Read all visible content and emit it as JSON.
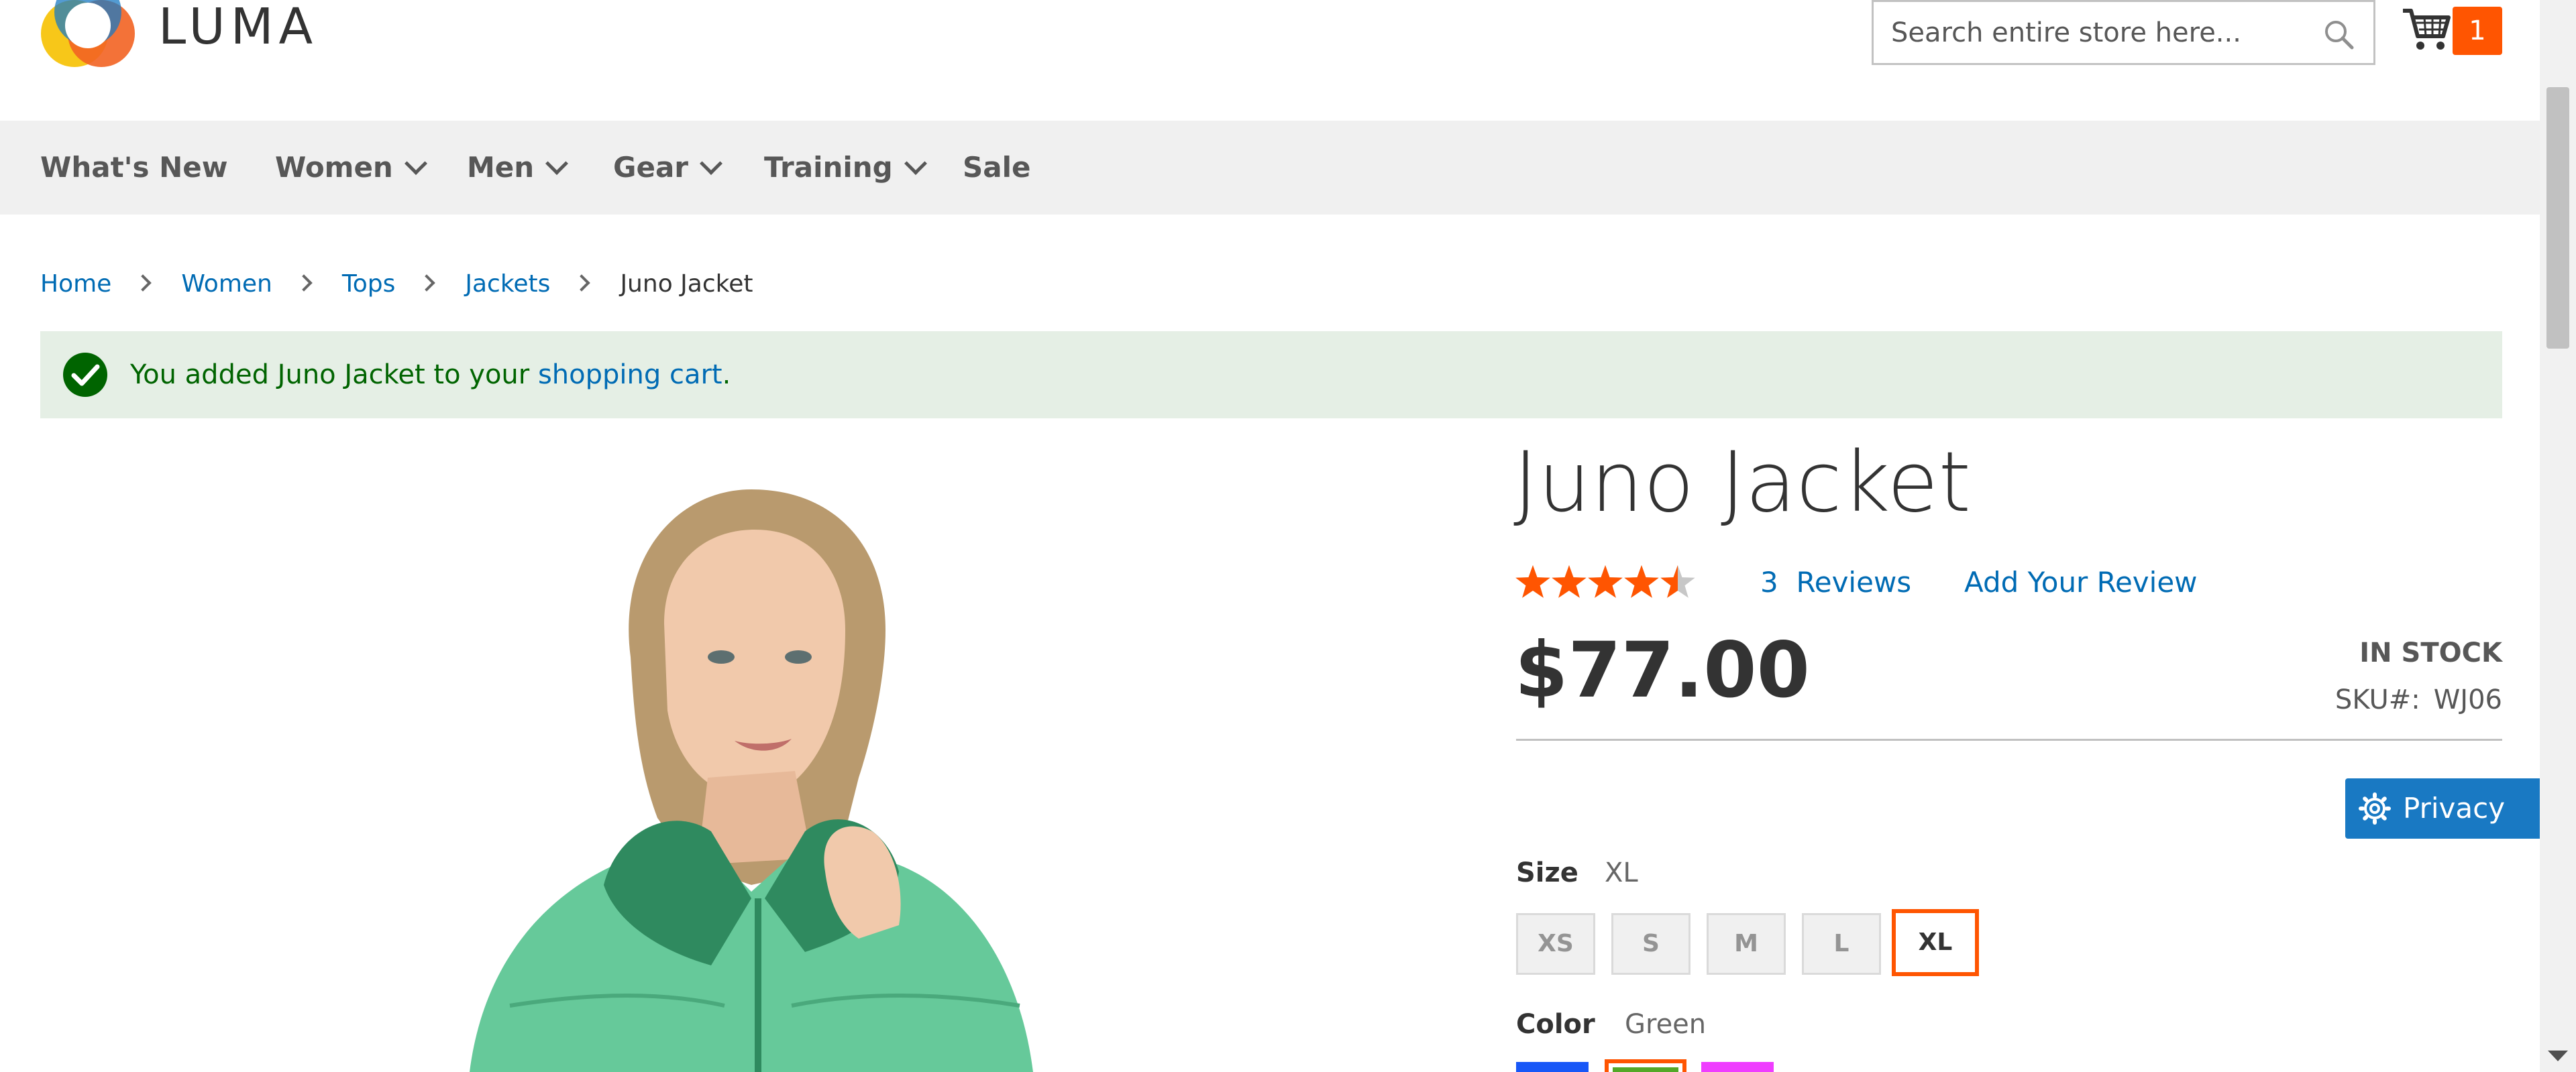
{
  "header": {
    "logo_text": "LUMA",
    "search_placeholder": "Search entire store here...",
    "cart_count": "1"
  },
  "nav": {
    "items": [
      {
        "label": "What's New",
        "has_dropdown": false
      },
      {
        "label": "Women",
        "has_dropdown": true
      },
      {
        "label": "Men",
        "has_dropdown": true
      },
      {
        "label": "Gear",
        "has_dropdown": true
      },
      {
        "label": "Training",
        "has_dropdown": true
      },
      {
        "label": "Sale",
        "has_dropdown": false
      }
    ]
  },
  "breadcrumb": {
    "items": [
      "Home",
      "Women",
      "Tops",
      "Jackets"
    ],
    "current": "Juno Jacket"
  },
  "message": {
    "text_before": "You added Juno Jacket to your ",
    "link_text": "shopping cart",
    "text_after": "."
  },
  "product": {
    "title": "Juno Jacket",
    "rating_percent": 90,
    "reviews_count": "3",
    "reviews_label": "Reviews",
    "add_review_label": "Add Your Review",
    "price": "$77.00",
    "stock": "IN STOCK",
    "sku_label": "SKU#:",
    "sku_value": "WJ06"
  },
  "options": {
    "size_label": "Size",
    "size_selected": "XL",
    "sizes": [
      "XS",
      "S",
      "M",
      "L",
      "XL"
    ],
    "color_label": "Color",
    "color_selected": "Green",
    "colors": [
      {
        "name": "Blue",
        "hex": "#1857f7"
      },
      {
        "name": "Green",
        "hex": "#53a828"
      },
      {
        "name": "Purple",
        "hex": "#ef3dff"
      }
    ]
  },
  "privacy": {
    "label": "Privacy"
  },
  "colors": {
    "accent_orange": "#ff5501",
    "link_blue": "#006bb4",
    "privacy_blue": "#1979c3",
    "success_green": "#006400"
  }
}
